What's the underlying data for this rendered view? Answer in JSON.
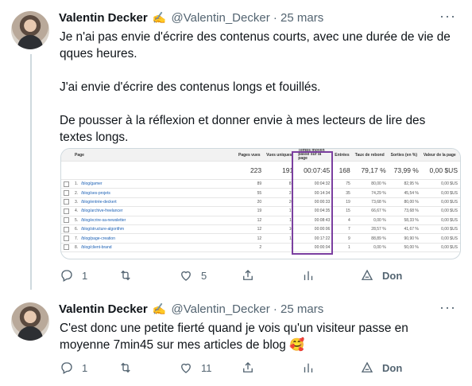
{
  "tweets": [
    {
      "author_name": "Valentin Decker",
      "handle": "@Valentin_Decker",
      "date": "25 mars",
      "paragraphs": [
        "Je n'ai pas envie d'écrire des contenus courts, avec une durée de vie de qques heures.",
        "J'ai envie d'écrire des contenus longs et fouillés.",
        "De pousser à la réflexion et donner envie à mes lecteurs de lire des textes longs."
      ],
      "reply_count": "1",
      "retweet_count": "",
      "like_count": "5",
      "donate_label": "Don"
    },
    {
      "author_name": "Valentin Decker",
      "handle": "@Valentin_Decker",
      "date": "25 mars",
      "paragraphs": [
        "C'est donc une petite fierté quand je vois qu'un visiteur passe en moyenne 7min45 sur mes articles de blog 🥰"
      ],
      "reply_count": "1",
      "retweet_count": "",
      "like_count": "11",
      "donate_label": "Don"
    }
  ],
  "embedded_image": {
    "headers": [
      "Page",
      "Pages vues",
      "Vues uniques",
      "Temps moyen passé sur la page",
      "Entrées",
      "Taux de rebond",
      "Sorties (en %)",
      "Valeur de la page"
    ],
    "totals": [
      "223",
      "191",
      "00:07:45",
      "168",
      "79,17 %",
      "73,99 %",
      "0,00 $US"
    ],
    "rows": [
      {
        "n": "1.",
        "page": "/blog/gamer",
        "views": "89",
        "uniq": "83",
        "time": "00:04:32",
        "ent": "75",
        "bounce": "80,00 %",
        "exit": "82,95 %",
        "val": "0,00 $US"
      },
      {
        "n": "2.",
        "page": "/blog/ses-projets",
        "views": "55",
        "uniq": "37",
        "time": "00:14:34",
        "ent": "35",
        "bounce": "74,29 %",
        "exit": "45,54 %",
        "val": "0,00 $US"
      },
      {
        "n": "3.",
        "page": "/blog/entrée-deckert",
        "views": "20",
        "uniq": "20",
        "time": "00:00:33",
        "ent": "19",
        "bounce": "73,68 %",
        "exit": "80,00 %",
        "val": "0,00 $US"
      },
      {
        "n": "4.",
        "page": "/blog/archive-freelancer",
        "views": "19",
        "uniq": "17",
        "time": "00:04:35",
        "ent": "15",
        "bounce": "66,67 %",
        "exit": "73,68 %",
        "val": "0,00 $US"
      },
      {
        "n": "5.",
        "page": "/blog/ecrire-sa-newsletter",
        "views": "12",
        "uniq": "11",
        "time": "00:08:43",
        "ent": "4",
        "bounce": "0,00 %",
        "exit": "58,33 %",
        "val": "0,00 $US"
      },
      {
        "n": "6.",
        "page": "/blog/structure-algorithm",
        "views": "12",
        "uniq": "10",
        "time": "00:00:06",
        "ent": "7",
        "bounce": "28,57 %",
        "exit": "41,67 %",
        "val": "0,00 $US"
      },
      {
        "n": "7.",
        "page": "/blog/page-creation",
        "views": "12",
        "uniq": "11",
        "time": "00:17:22",
        "ent": "9",
        "bounce": "88,89 %",
        "exit": "90,90 %",
        "val": "0,00 $US"
      },
      {
        "n": "8.",
        "page": "/blog/client-brand",
        "views": "2",
        "uniq": "2",
        "time": "00:00:04",
        "ent": "1",
        "bounce": "0,00 %",
        "exit": "50,00 %",
        "val": "0,00 $US"
      }
    ]
  }
}
